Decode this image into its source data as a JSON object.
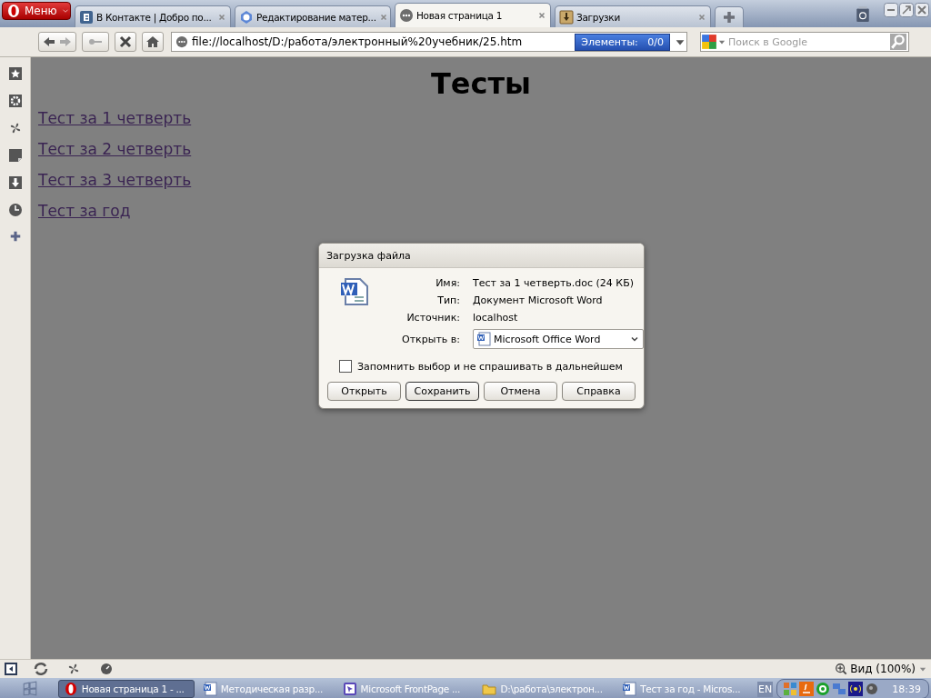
{
  "browser": {
    "menu_label": "Меню",
    "tabs": [
      {
        "title": "В Контакте | Добро по...",
        "kind": "vk",
        "selected": false
      },
      {
        "title": "Редактирование матер...",
        "kind": "cms",
        "selected": false
      },
      {
        "title": "Новая страница 1",
        "kind": "page",
        "selected": true
      },
      {
        "title": "Загрузки",
        "kind": "downloads",
        "selected": false
      }
    ],
    "address": "file://localhost/D:/работа/электронный%20учебник/25.htm",
    "elements_badge": "Элементы:   0/0",
    "search": {
      "placeholder": "Поиск в Google"
    }
  },
  "page": {
    "heading": "Тесты",
    "links": [
      "Тест за 1 четверть",
      "Тест за 2 четверть",
      "Тест за 3 четверть",
      "Тест за год"
    ]
  },
  "dialog": {
    "title": "Загрузка файла",
    "fields": [
      {
        "label": "Имя:",
        "value": "Тест за 1 четверть.doc (24 КБ)"
      },
      {
        "label": "Тип:",
        "value": "Документ Microsoft Word"
      },
      {
        "label": "Источник:",
        "value": "localhost"
      }
    ],
    "open_with": {
      "label": "Открыть в:",
      "value": "Microsoft Office Word"
    },
    "remember": {
      "label": "Запомнить выбор и не спрашивать в дальнейшем",
      "checked": false
    },
    "buttons": [
      {
        "label": "Открыть",
        "selected": false
      },
      {
        "label": "Сохранить",
        "selected": true
      },
      {
        "label": "Отмена",
        "selected": false
      },
      {
        "label": "Справка",
        "selected": false
      }
    ]
  },
  "status_bar": {
    "zoom": "Вид (100%)"
  },
  "taskbar": {
    "items": [
      {
        "label": "Новая страница 1 - ...",
        "kind": "opera",
        "selected": true
      },
      {
        "label": "Методическая разр...",
        "kind": "word",
        "selected": false
      },
      {
        "label": "Microsoft FrontPage ...",
        "kind": "frontpage",
        "selected": false
      },
      {
        "label": "D:\\работа\\электрон...",
        "kind": "folder",
        "selected": false
      },
      {
        "label": "Тест за год - Micros...",
        "kind": "word",
        "selected": false
      }
    ],
    "language": "EN",
    "clock": "18:39"
  }
}
